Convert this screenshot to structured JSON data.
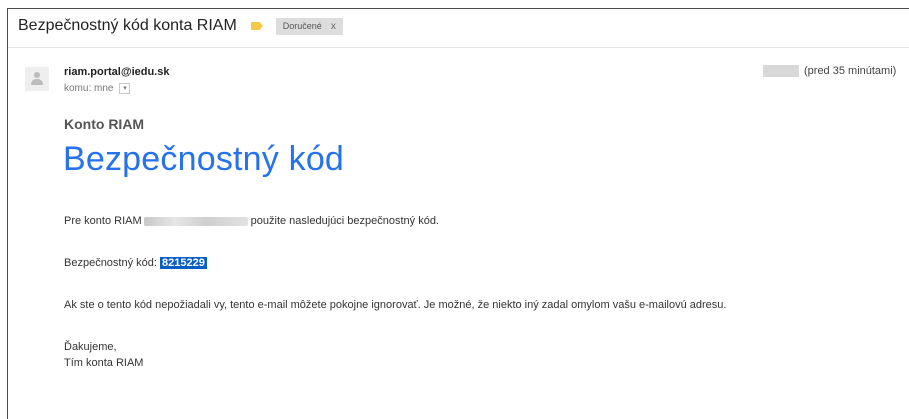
{
  "email": {
    "subject": "Bezpečnostný kód konta RIAM",
    "label_chip": "Doručené",
    "chip_close": "x",
    "sender": "riam.portal@iedu.sk",
    "recipient_line": "komu: mne",
    "time": "(pred 35 minútami)"
  },
  "body": {
    "brand": "Konto RIAM",
    "title": "Bezpečnostný kód",
    "line1_before": "Pre konto RIAM",
    "line1_after": "použite nasledujúci bezpečnostný kód.",
    "code_label": "Bezpečnostný kód:",
    "code": "8215229",
    "line3": "Ak ste o tento kód nepožiadali vy, tento e-mail môžete pokojne ignorovať. Je možné, že niekto iný zadal omylom vašu e-mailovú adresu.",
    "thanks": "Ďakujeme,",
    "team": "Tím konta RIAM"
  },
  "colors": {
    "title_blue": "#2672ec",
    "code_highlight": "#0a5fc4",
    "label_tag": "#f7c948"
  },
  "icons": {
    "avatar": "person-icon",
    "label": "label-tag-icon",
    "dropdown": "chevron-down-icon"
  }
}
